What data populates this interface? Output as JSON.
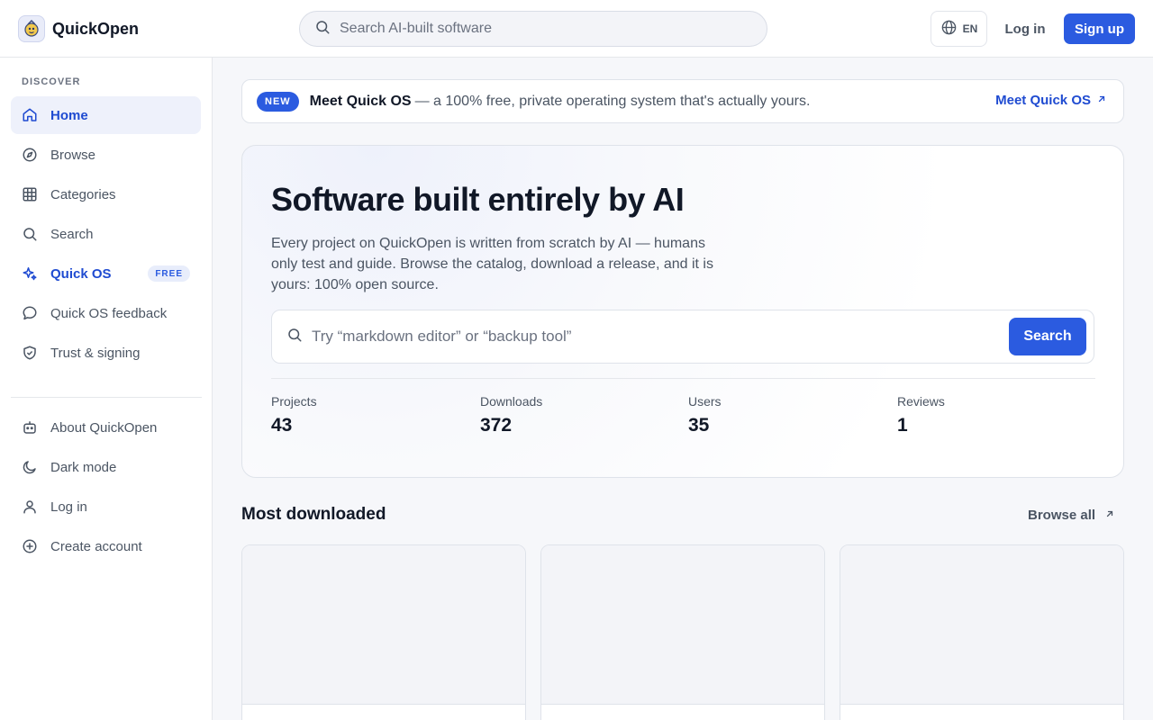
{
  "header": {
    "brand_name": "QuickOpen",
    "search_placeholder": "Search AI-built software",
    "language": "EN",
    "login_label": "Log in",
    "signup_label": "Sign up"
  },
  "sidebar": {
    "heading": "DISCOVER",
    "items": [
      {
        "label": "Home",
        "icon": "home-icon",
        "active": true
      },
      {
        "label": "Browse",
        "icon": "compass-icon"
      },
      {
        "label": "Categories",
        "icon": "grid-icon"
      },
      {
        "label": "Search",
        "icon": "search-icon"
      },
      {
        "label": "Quick OS",
        "icon": "sparkles-icon",
        "badge": "FREE"
      },
      {
        "label": "Quick OS feedback",
        "icon": "chat-bubble-icon"
      },
      {
        "label": "Trust & signing",
        "icon": "shield-check-icon"
      }
    ],
    "secondary_items": [
      {
        "label": "About QuickOpen",
        "icon": "robot-icon"
      },
      {
        "label": "Dark mode",
        "icon": "moon-icon"
      },
      {
        "label": "Log in",
        "icon": "user-icon"
      },
      {
        "label": "Create account",
        "icon": "plus-circle-icon"
      }
    ]
  },
  "announcement": {
    "badge": "NEW",
    "title": "Meet Quick OS",
    "text": "— a 100% free, private operating system that's actually yours.",
    "link_label": "Meet Quick OS"
  },
  "hero": {
    "title": "Software built entirely by AI",
    "description": "Every project on QuickOpen is written from scratch by AI — humans only test and guide. Browse the catalog, download a release, and it is yours: 100% open source.",
    "search_placeholder": "Try “markdown editor” or “backup tool”",
    "search_button": "Search",
    "stats": [
      {
        "label": "Projects",
        "value": "43"
      },
      {
        "label": "Downloads",
        "value": "372"
      },
      {
        "label": "Users",
        "value": "35"
      },
      {
        "label": "Reviews",
        "value": "1"
      }
    ]
  },
  "most_downloaded": {
    "title": "Most downloaded",
    "browse_all_label": "Browse all"
  },
  "colors": {
    "accent": "#2b5be0",
    "accent_text": "#1f4bd1",
    "active_bg": "#eef1fb"
  }
}
